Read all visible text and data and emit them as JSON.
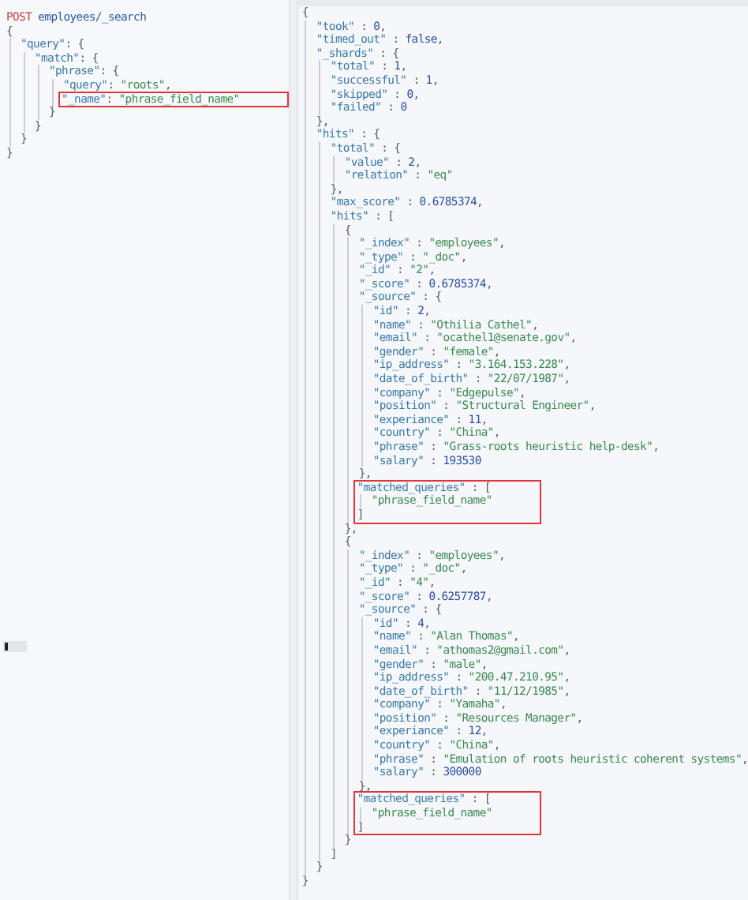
{
  "request": {
    "method": "POST",
    "path": "employees/_search",
    "body": [
      {
        "text": "{",
        "highlighted": false,
        "children": [
          {
            "text": "\"query\": {",
            "highlighted": false,
            "children": [
              {
                "text": "\"match\": {",
                "highlighted": false,
                "children": [
                  {
                    "text": "\"phrase\": {",
                    "highlighted": false,
                    "children": [
                      {
                        "text": "\"query\": \"roots\",",
                        "highlighted": false
                      },
                      {
                        "text": "\"_name\": \"phrase_field_name\"",
                        "highlighted": true
                      }
                    ]
                  },
                  {
                    "text": "}",
                    "highlighted": false
                  }
                ]
              },
              {
                "text": "}",
                "highlighted": false
              }
            ]
          },
          {
            "text": "}",
            "highlighted": false
          }
        ]
      },
      {
        "text": "}",
        "highlighted": false
      }
    ]
  },
  "response": {
    "body": [
      {
        "text": "{",
        "highlighted": false,
        "children": [
          {
            "text": "\"took\" : 0,",
            "highlighted": false
          },
          {
            "text": "\"timed_out\" : false,",
            "highlighted": false
          },
          {
            "text": "\"_shards\" : {",
            "highlighted": false,
            "children": [
              {
                "text": "\"total\" : 1,",
                "highlighted": false
              },
              {
                "text": "\"successful\" : 1,",
                "highlighted": false
              },
              {
                "text": "\"skipped\" : 0,",
                "highlighted": false
              },
              {
                "text": "\"failed\" : 0",
                "highlighted": false
              }
            ]
          },
          {
            "text": "},",
            "highlighted": false
          },
          {
            "text": "\"hits\" : {",
            "highlighted": false,
            "children": [
              {
                "text": "\"total\" : {",
                "highlighted": false,
                "children": [
                  {
                    "text": "\"value\" : 2,",
                    "highlighted": false
                  },
                  {
                    "text": "\"relation\" : \"eq\"",
                    "highlighted": false
                  }
                ]
              },
              {
                "text": "},",
                "highlighted": false
              },
              {
                "text": "\"max_score\" : 0.6785374,",
                "highlighted": false
              },
              {
                "text": "\"hits\" : [",
                "highlighted": false,
                "children": [
                  {
                    "text": "{",
                    "highlighted": false,
                    "children": [
                      {
                        "text": "\"_index\" : \"employees\",",
                        "highlighted": false
                      },
                      {
                        "text": "\"_type\" : \"_doc\",",
                        "highlighted": false
                      },
                      {
                        "text": "\"_id\" : \"2\",",
                        "highlighted": false
                      },
                      {
                        "text": "\"_score\" : 0.6785374,",
                        "highlighted": false
                      },
                      {
                        "text": "\"_source\" : {",
                        "highlighted": false,
                        "children": [
                          {
                            "text": "\"id\" : 2,",
                            "highlighted": false
                          },
                          {
                            "text": "\"name\" : \"Othilia Cathel\",",
                            "highlighted": false
                          },
                          {
                            "text": "\"email\" : \"ocathel1@senate.gov\",",
                            "highlighted": false
                          },
                          {
                            "text": "\"gender\" : \"female\",",
                            "highlighted": false
                          },
                          {
                            "text": "\"ip_address\" : \"3.164.153.228\",",
                            "highlighted": false
                          },
                          {
                            "text": "\"date_of_birth\" : \"22/07/1987\",",
                            "highlighted": false
                          },
                          {
                            "text": "\"company\" : \"Edgepulse\",",
                            "highlighted": false
                          },
                          {
                            "text": "\"position\" : \"Structural Engineer\",",
                            "highlighted": false
                          },
                          {
                            "text": "\"experiance\" : 11,",
                            "highlighted": false
                          },
                          {
                            "text": "\"country\" : \"China\",",
                            "highlighted": false
                          },
                          {
                            "text": "\"phrase\" : \"Grass-roots heuristic help-desk\",",
                            "highlighted": false
                          },
                          {
                            "text": "\"salary\" : 193530",
                            "highlighted": false
                          }
                        ]
                      },
                      {
                        "text": "},",
                        "highlighted": false
                      },
                      {
                        "text": "\"matched_queries\" : [",
                        "highlighted": true,
                        "children": [
                          {
                            "text": "\"phrase_field_name\"",
                            "highlighted": true
                          }
                        ]
                      },
                      {
                        "text": "]",
                        "highlighted": true
                      }
                    ]
                  },
                  {
                    "text": "},",
                    "highlighted": false
                  },
                  {
                    "text": "{",
                    "highlighted": false,
                    "children": [
                      {
                        "text": "\"_index\" : \"employees\",",
                        "highlighted": false
                      },
                      {
                        "text": "\"_type\" : \"_doc\",",
                        "highlighted": false
                      },
                      {
                        "text": "\"_id\" : \"4\",",
                        "highlighted": false
                      },
                      {
                        "text": "\"_score\" : 0.6257787,",
                        "highlighted": false
                      },
                      {
                        "text": "\"_source\" : {",
                        "highlighted": false,
                        "children": [
                          {
                            "text": "\"id\" : 4,",
                            "highlighted": false
                          },
                          {
                            "text": "\"name\" : \"Alan Thomas\",",
                            "highlighted": false
                          },
                          {
                            "text": "\"email\" : \"athomas2@gmail.com\",",
                            "highlighted": false
                          },
                          {
                            "text": "\"gender\" : \"male\",",
                            "highlighted": false
                          },
                          {
                            "text": "\"ip_address\" : \"200.47.210.95\",",
                            "highlighted": false
                          },
                          {
                            "text": "\"date_of_birth\" : \"11/12/1985\",",
                            "highlighted": false
                          },
                          {
                            "text": "\"company\" : \"Yamaha\",",
                            "highlighted": false
                          },
                          {
                            "text": "\"position\" : \"Resources Manager\",",
                            "highlighted": false
                          },
                          {
                            "text": "\"experiance\" : 12,",
                            "highlighted": false
                          },
                          {
                            "text": "\"country\" : \"China\",",
                            "highlighted": false
                          },
                          {
                            "text": "\"phrase\" : \"Emulation of roots heuristic coherent systems\",",
                            "highlighted": false
                          },
                          {
                            "text": "\"salary\" : 300000",
                            "highlighted": false
                          }
                        ]
                      },
                      {
                        "text": "},",
                        "highlighted": false
                      },
                      {
                        "text": "\"matched_queries\" : [",
                        "highlighted": true,
                        "children": [
                          {
                            "text": "\"phrase_field_name\"",
                            "highlighted": true
                          }
                        ]
                      },
                      {
                        "text": "]",
                        "highlighted": true
                      }
                    ]
                  },
                  {
                    "text": "}",
                    "highlighted": false
                  }
                ]
              },
              {
                "text": "]",
                "highlighted": false
              }
            ]
          },
          {
            "text": "}",
            "highlighted": false
          }
        ]
      },
      {
        "text": "}",
        "highlighted": false
      }
    ]
  }
}
